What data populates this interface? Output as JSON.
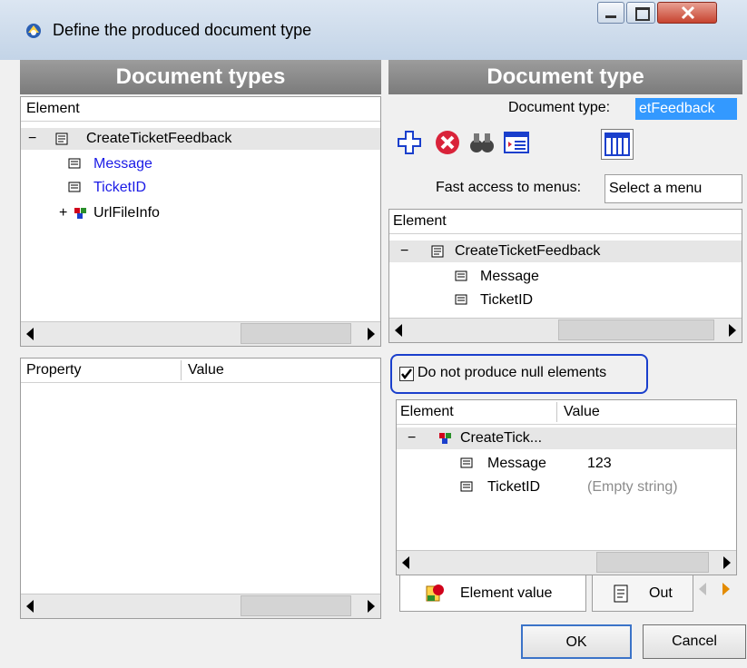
{
  "window": {
    "title": "Define the produced document type"
  },
  "left": {
    "header": "Document types",
    "tree": {
      "column": "Element",
      "root": "CreateTicketFeedback",
      "children": [
        "Message",
        "TicketID",
        "UrlFileInfo"
      ]
    },
    "properties": {
      "col_property": "Property",
      "col_value": "Value"
    }
  },
  "right": {
    "header": "Document type",
    "doc_type_label": "Document type:",
    "doc_type_value": "etFeedback",
    "fast_access_label": "Fast access to menus:",
    "fast_access_value": "Select a menu",
    "tree": {
      "column": "Element",
      "root": "CreateTicketFeedback",
      "children": [
        "Message",
        "TicketID"
      ]
    },
    "checkbox_label": "Do not produce null elements",
    "values": {
      "col_element": "Element",
      "col_value": "Value",
      "root": "CreateTick...",
      "rows": [
        {
          "name": "Message",
          "value": "123"
        },
        {
          "name": "TicketID",
          "value": "(Empty string)"
        }
      ]
    },
    "tabs": [
      "Element value",
      "Out"
    ]
  },
  "buttons": {
    "ok": "OK",
    "cancel": "Cancel"
  },
  "icons": [
    "app-icon",
    "add-icon",
    "delete-icon",
    "binoculars-icon",
    "view-icon",
    "table-icon",
    "document-icon",
    "field-icon",
    "node-icon"
  ]
}
